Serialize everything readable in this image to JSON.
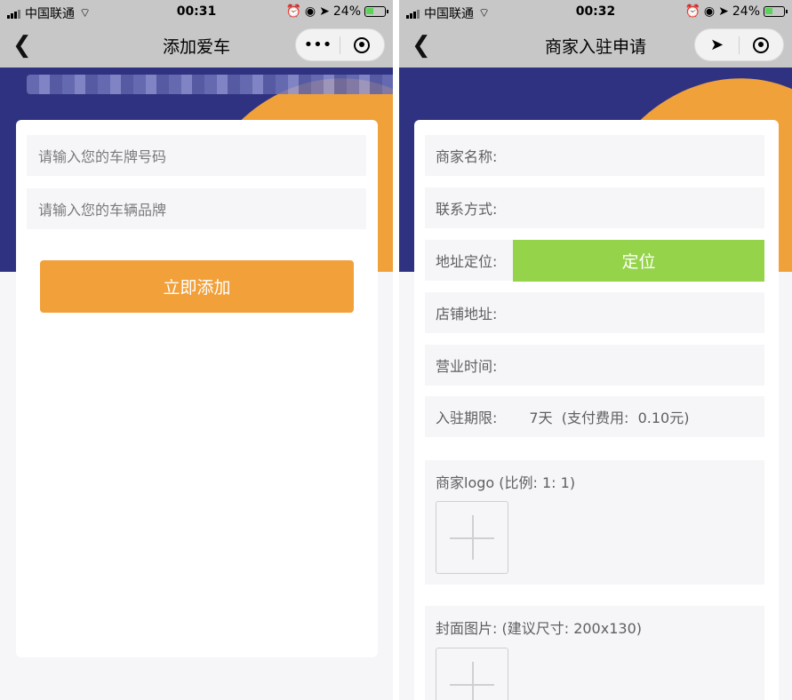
{
  "left": {
    "status": {
      "carrier": "中国联通",
      "time": "00:31",
      "battery": "24%"
    },
    "nav": {
      "title": "添加爱车",
      "back": "‹",
      "more": "•••"
    },
    "form": {
      "plate_placeholder": "请输入您的车牌号码",
      "brand_placeholder": "请输入您的车辆品牌",
      "submit_label": "立即添加"
    }
  },
  "right": {
    "status": {
      "carrier": "中国联通",
      "time": "00:32",
      "battery": "24%"
    },
    "nav": {
      "title": "商家入驻申请",
      "back": "‹"
    },
    "form": {
      "merchant_name_label": "商家名称:",
      "contact_label": "联系方式:",
      "address_locate_label": "地址定位:",
      "locate_button": "定位",
      "shop_address_label": "店铺地址:",
      "business_hours_label": "营业时间:",
      "term_label": "入驻期限:",
      "term_value": "7天  (支付费用:  0.10元)",
      "logo_label": "商家logo (比例: 1: 1)",
      "cover_label": "封面图片: (建议尺寸: 200x130)"
    }
  }
}
